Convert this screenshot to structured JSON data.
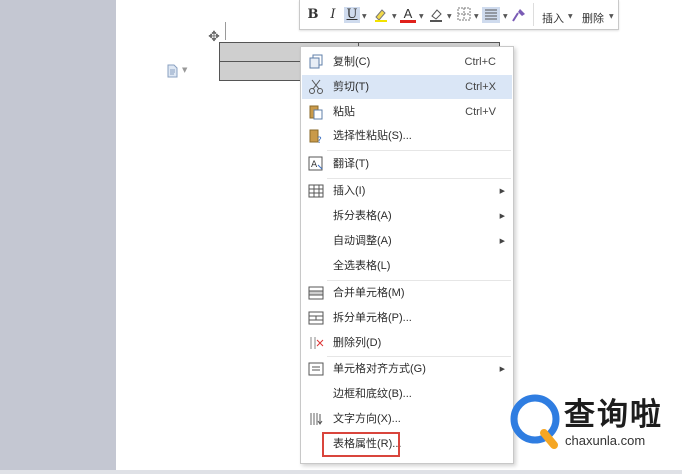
{
  "toolbar": {
    "bold": "B",
    "italic": "I",
    "underline": "U",
    "font_color": "A",
    "insert_label": "插入",
    "delete_label": "删除"
  },
  "context_menu": {
    "items": [
      {
        "label": "复制(C)",
        "shortcut": "Ctrl+C",
        "icon": "copy-icon"
      },
      {
        "label": "剪切(T)",
        "shortcut": "Ctrl+X",
        "icon": "scissors-icon",
        "highlighted": true
      },
      {
        "label": "粘贴",
        "shortcut": "Ctrl+V",
        "icon": "paste-icon"
      },
      {
        "label": "选择性粘贴(S)...",
        "icon": "paste-special-icon"
      },
      {
        "label": "翻译(T)",
        "icon": "translate-icon"
      },
      {
        "label": "插入(I)",
        "icon": "table-insert-icon",
        "submenu": true
      },
      {
        "label": "拆分表格(A)",
        "submenu": true
      },
      {
        "label": "自动调整(A)",
        "submenu": true
      },
      {
        "label": "全选表格(L)"
      },
      {
        "label": "合并单元格(M)",
        "icon": "merge-cells-icon"
      },
      {
        "label": "拆分单元格(P)...",
        "icon": "split-cells-icon"
      },
      {
        "label": "删除列(D)",
        "icon": "delete-column-icon"
      },
      {
        "label": "单元格对齐方式(G)",
        "icon": "cell-align-icon",
        "submenu": true
      },
      {
        "label": "边框和底纹(B)..."
      },
      {
        "label": "文字方向(X)...",
        "icon": "text-direction-icon"
      },
      {
        "label": "表格属性(R)...",
        "outlined": true
      }
    ]
  },
  "watermark": {
    "brand": "查询啦",
    "domain": "chaxunla.com"
  },
  "colors": {
    "workspace_bg": "#c4c7d2",
    "menu_highlight": "#dae6f6",
    "outline_red": "#d9453c",
    "watermark_blue": "#2f7de1",
    "watermark_orange": "#f5a623"
  }
}
